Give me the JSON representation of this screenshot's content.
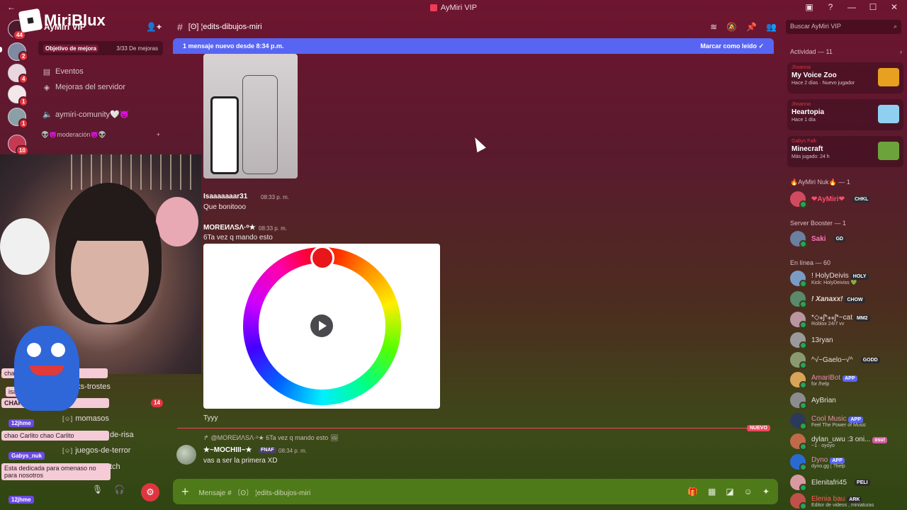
{
  "window": {
    "title": "AyMiri VIP",
    "controls": [
      "▣",
      "?",
      "—",
      "☐",
      "✕"
    ]
  },
  "overlay": {
    "logo_text": "MiriBlux",
    "chat": [
      {
        "name": "",
        "text": "chao"
      },
      {
        "name": "",
        "text": "isa"
      },
      {
        "name": "",
        "text": "CHARLIT"
      },
      {
        "name": "12jhme",
        "text": "chao Carlito chao Carlito"
      },
      {
        "name": "Gabys_nuk",
        "text": "Esta dedicada para omenaso no para nosotros"
      },
      {
        "name": "12jhme",
        "text": ""
      }
    ]
  },
  "rail": {
    "badges": [
      "44",
      "2",
      "4",
      "1",
      "1",
      "10"
    ]
  },
  "sidebar": {
    "server_name": "AyMiri VIP",
    "boost_label": "Objetivo de mejora",
    "boost_progress": "3/33 De mejoras",
    "items": [
      {
        "icon": "calendar-icon",
        "label": "Eventos"
      },
      {
        "icon": "boost-icon",
        "label": "Mejoras del servidor"
      },
      {
        "icon": "speaker-icon",
        "label": "aymiri-comunity🤍😈"
      }
    ],
    "category": "👽😈moderación😈👽",
    "lower_channels": [
      {
        "prefix": "",
        "label": "tiktoks-trostes"
      },
      {
        "prefix": "[☺]",
        "label": "momasos"
      },
      {
        "prefix": "",
        "label": "de-risa"
      },
      {
        "prefix": "[☺]",
        "label": "juegos-de-terror"
      },
      {
        "prefix": "",
        "label": "tch"
      }
    ],
    "lower_badge": "14"
  },
  "channel": {
    "name": "[ʘ] ¦edits-dibujos-miri",
    "new_message_banner": "1 mensaje nuevo desde 8:34 p.m.",
    "mark_read": "Marcar como leído"
  },
  "search": {
    "placeholder": "Buscar AyMiri VIP"
  },
  "messages": [
    {
      "author": "Isaaaaaaar31",
      "time": "08:33 p. m.",
      "text": "Que bonitooo"
    },
    {
      "author": "MOREИΛSΛ·ᵒ★",
      "time": "08:33 p. m.",
      "text": "6Ta vez q mando esto"
    },
    {
      "author": "",
      "time": "",
      "text": "Tyyy"
    }
  ],
  "new_divider": "NUEVO",
  "reply": {
    "quote": "@MOREИΛSΛ·ᵒ★ 6Ta vez q mando esto",
    "author": "★~MOCHIII~★",
    "tag": "FNAF",
    "time": "08:34 p. m.",
    "text": "vas a ser la primera XD"
  },
  "composer": {
    "placeholder": "Mensaje # 〔ʘ〕 ¦edits-dibujos-miri"
  },
  "members": {
    "activity_header": "Actividad — 11",
    "activities": [
      {
        "user": "Jhoanna",
        "game": "My Voice Zoo",
        "sub": "Hace 2 días  ·  Nuevo jugador",
        "color": "#e8a020"
      },
      {
        "user": "Jhoanna",
        "game": "Heartopia",
        "sub": "Hace 1 día",
        "color": "#8fd0f0"
      },
      {
        "user": "Gabys Falk",
        "game": "Minecraft",
        "sub": "Más jugado: 24 h",
        "color": "#6ca33a"
      }
    ],
    "group1_header": "🔥AyMiri Nuk🔥 — 1",
    "group1": [
      {
        "name": "❤AyMiri❤",
        "tag": "CHKL",
        "status": ""
      }
    ],
    "booster_header": "Server Booster — 1",
    "booster": [
      {
        "name": "Saki",
        "tag": "GD",
        "status": ""
      }
    ],
    "online_header": "En línea — 60",
    "online": [
      {
        "name": "! HolyDeivis",
        "tag": "HOLY",
        "status": "Kick: HolyDeiviss 💚"
      },
      {
        "name": "! Xanaxx!",
        "tag": "CHOW",
        "status": ""
      },
      {
        "name": "*◇⁎ʃ*⁎⁎ʃ*~cat",
        "tag": "MM2",
        "status": "Roblox 24/7 vv"
      },
      {
        "name": "13ryan",
        "tag": "",
        "status": ""
      },
      {
        "name": "^√~Gaelo~√^",
        "tag": "GODD",
        "status": ""
      },
      {
        "name": "AmariBot",
        "tag": "APP",
        "status": "for /help"
      },
      {
        "name": "AyBrian",
        "tag": "",
        "status": ""
      },
      {
        "name": "Cool Music",
        "tag": "APP",
        "status": "Feel The Power of Music"
      },
      {
        "name": "dylan_uwu :3 oni...",
        "tag": "osu!",
        "status": "~1 · oyoyo"
      },
      {
        "name": "Dyno",
        "tag": "APP",
        "status": "dyno.gg | ?help"
      },
      {
        "name": "Elenitafri45",
        "tag": "PELI",
        "status": ""
      },
      {
        "name": "Elenia bau",
        "tag": "ARK",
        "status": "Editor de videos , miniaturas"
      }
    ]
  }
}
